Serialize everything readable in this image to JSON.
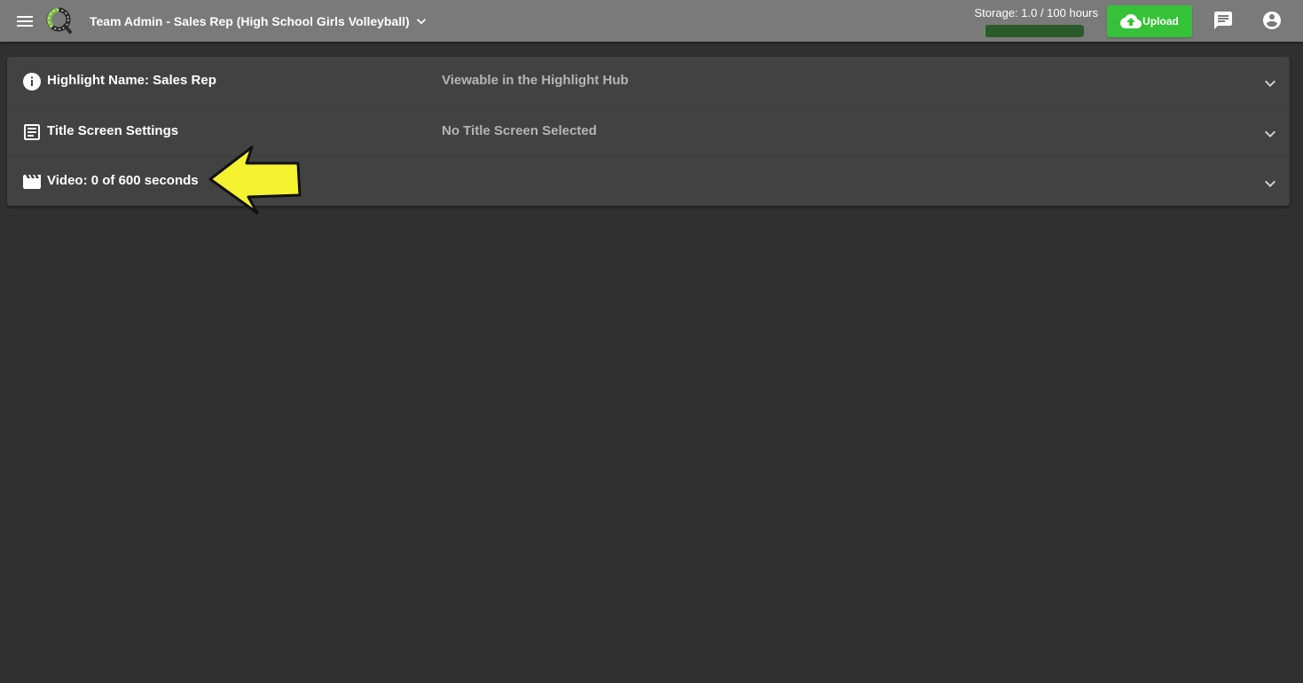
{
  "header": {
    "menu_icon": "hamburger-menu-icon",
    "logo_icon": "app-logo-icon",
    "team_title": "Team Admin - Sales Rep (High School Girls Volleyball)",
    "team_chevron_icon": "chevron-down-icon",
    "storage": {
      "label": "Storage: 1.0 / 100 hours",
      "used_hours": 1.0,
      "total_hours": 100,
      "fill_fraction": 0.01,
      "track_color": "#2d5a2b"
    },
    "upload": {
      "label": "Upload",
      "icon": "cloud-upload-icon",
      "color": "#35c238"
    },
    "chat_icon": "chat-icon",
    "account_icon": "account-circle-icon"
  },
  "panel": {
    "rows": [
      {
        "icon": "info-icon",
        "title": "Highlight Name: Sales Rep",
        "subtitle": "Viewable in the Highlight Hub",
        "chevron_icon": "chevron-down-icon"
      },
      {
        "icon": "title-screen-icon",
        "title": "Title Screen Settings",
        "subtitle": "No Title Screen Selected",
        "chevron_icon": "chevron-down-icon"
      },
      {
        "icon": "clapperboard-icon",
        "title": "Video: 0 of 600 seconds",
        "subtitle": "",
        "chevron_icon": "chevron-down-icon"
      }
    ]
  },
  "annotation": {
    "icon": "yellow-arrow-annotation",
    "color": "#f5f230"
  },
  "colors": {
    "topbar": "#7a7a7a",
    "background": "#303030",
    "panel": "#424242",
    "subtitle_text": "#b5b5b5"
  }
}
